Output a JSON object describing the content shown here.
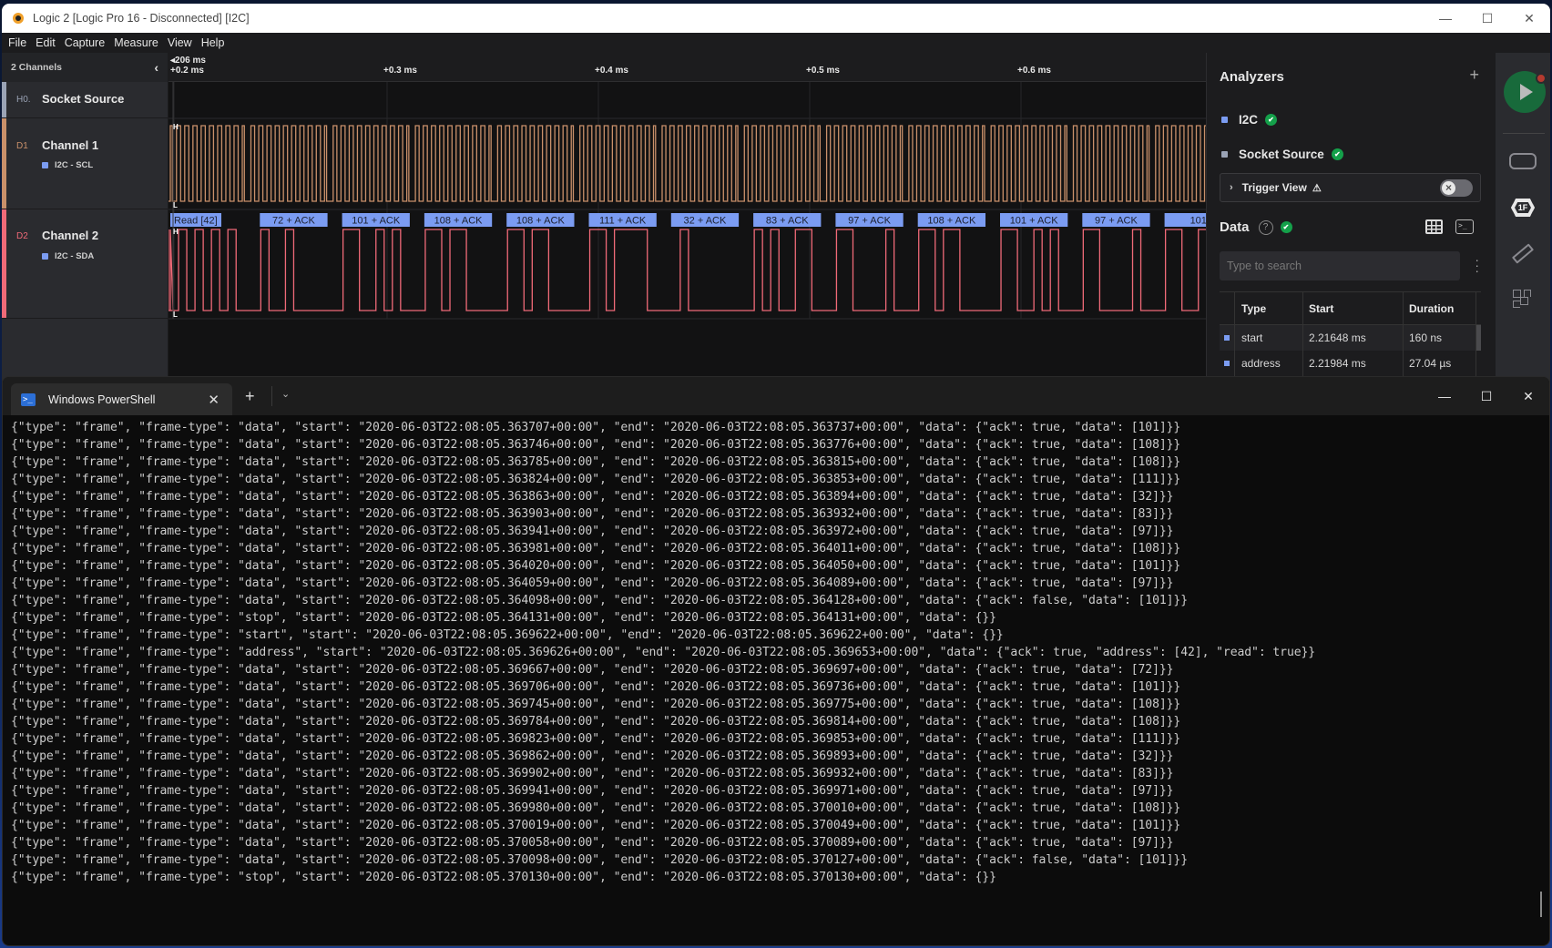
{
  "window": {
    "title": "Logic 2 [Logic Pro 16 - Disconnected] [I2C]",
    "controls": [
      "minimize",
      "maximize",
      "close"
    ]
  },
  "menu": [
    "File",
    "Edit",
    "Capture",
    "Measure",
    "View",
    "Help"
  ],
  "channels_panel": {
    "header": "2 Channels",
    "collapse_icon": "chevron-left-icon",
    "rows": [
      {
        "id": "H0.",
        "name": "Socket Source",
        "sub": "",
        "color": "#9aa3b5"
      },
      {
        "id": "D1",
        "name": "Channel 1",
        "sub": "I2C - SCL",
        "color": "#c9906a"
      },
      {
        "id": "D2",
        "name": "Channel 2",
        "sub": "I2C - SDA",
        "color": "#f06a78"
      }
    ]
  },
  "timeline": {
    "origin": "206 ms",
    "ticks": [
      "+0.2 ms",
      "+0.3 ms",
      "+0.4 ms",
      "+0.5 ms",
      "+0.6 ms"
    ],
    "level_high": "H",
    "level_low": "L"
  },
  "waveform": {
    "scl_color": "#c9906a",
    "sda_color": "#f06a78",
    "frame_label_color": "#7b9cf2",
    "frames": [
      {
        "label": "Read [42]",
        "value": 42,
        "kind": "address"
      },
      {
        "label": "72 + ACK",
        "value": 72,
        "kind": "data"
      },
      {
        "label": "101 + ACK",
        "value": 101,
        "kind": "data"
      },
      {
        "label": "108 + ACK",
        "value": 108,
        "kind": "data"
      },
      {
        "label": "108 + ACK",
        "value": 108,
        "kind": "data"
      },
      {
        "label": "111 + ACK",
        "value": 111,
        "kind": "data"
      },
      {
        "label": "32 + ACK",
        "value": 32,
        "kind": "data"
      },
      {
        "label": "83 + ACK",
        "value": 83,
        "kind": "data"
      },
      {
        "label": "97 + ACK",
        "value": 97,
        "kind": "data"
      },
      {
        "label": "108 + ACK",
        "value": 108,
        "kind": "data"
      },
      {
        "label": "101 + ACK",
        "value": 101,
        "kind": "data"
      },
      {
        "label": "97 + ACK",
        "value": 97,
        "kind": "data"
      },
      {
        "label": "101",
        "value": 101,
        "kind": "data"
      }
    ]
  },
  "analyzers": {
    "title": "Analyzers",
    "add_icon": "plus-icon",
    "items": [
      {
        "name": "I2C",
        "color": "#7b9cf2",
        "status": "ok"
      },
      {
        "name": "Socket Source",
        "color": "#9aa3b5",
        "status": "ok"
      }
    ],
    "trigger_view": {
      "label": "Trigger View",
      "warning_icon": "warning-icon",
      "enabled": false
    }
  },
  "data_panel": {
    "title": "Data",
    "search_placeholder": "Type to search",
    "columns": [
      "Type",
      "Start",
      "Duration"
    ],
    "rows": [
      {
        "type": "start",
        "start": "2.21648 ms",
        "duration": "160 ns"
      },
      {
        "type": "address",
        "start": "2.21984 ms",
        "duration": "27.04 µs"
      }
    ]
  },
  "toolstrip": {
    "run_button": "start-capture",
    "icons": [
      "device-settings-icon",
      "analyzers-1f-icon",
      "measure-ruler-icon",
      "extensions-icon"
    ]
  },
  "terminal": {
    "tab_label": "Windows PowerShell",
    "new_tab": "+",
    "lines": [
      "{\"type\": \"frame\", \"frame-type\": \"data\", \"start\": \"2020-06-03T22:08:05.363707+00:00\", \"end\": \"2020-06-03T22:08:05.363737+00:00\", \"data\": {\"ack\": true, \"data\": [101]}}",
      "{\"type\": \"frame\", \"frame-type\": \"data\", \"start\": \"2020-06-03T22:08:05.363746+00:00\", \"end\": \"2020-06-03T22:08:05.363776+00:00\", \"data\": {\"ack\": true, \"data\": [108]}}",
      "{\"type\": \"frame\", \"frame-type\": \"data\", \"start\": \"2020-06-03T22:08:05.363785+00:00\", \"end\": \"2020-06-03T22:08:05.363815+00:00\", \"data\": {\"ack\": true, \"data\": [108]}}",
      "{\"type\": \"frame\", \"frame-type\": \"data\", \"start\": \"2020-06-03T22:08:05.363824+00:00\", \"end\": \"2020-06-03T22:08:05.363853+00:00\", \"data\": {\"ack\": true, \"data\": [111]}}",
      "{\"type\": \"frame\", \"frame-type\": \"data\", \"start\": \"2020-06-03T22:08:05.363863+00:00\", \"end\": \"2020-06-03T22:08:05.363894+00:00\", \"data\": {\"ack\": true, \"data\": [32]}}",
      "{\"type\": \"frame\", \"frame-type\": \"data\", \"start\": \"2020-06-03T22:08:05.363903+00:00\", \"end\": \"2020-06-03T22:08:05.363932+00:00\", \"data\": {\"ack\": true, \"data\": [83]}}",
      "{\"type\": \"frame\", \"frame-type\": \"data\", \"start\": \"2020-06-03T22:08:05.363941+00:00\", \"end\": \"2020-06-03T22:08:05.363972+00:00\", \"data\": {\"ack\": true, \"data\": [97]}}",
      "{\"type\": \"frame\", \"frame-type\": \"data\", \"start\": \"2020-06-03T22:08:05.363981+00:00\", \"end\": \"2020-06-03T22:08:05.364011+00:00\", \"data\": {\"ack\": true, \"data\": [108]}}",
      "{\"type\": \"frame\", \"frame-type\": \"data\", \"start\": \"2020-06-03T22:08:05.364020+00:00\", \"end\": \"2020-06-03T22:08:05.364050+00:00\", \"data\": {\"ack\": true, \"data\": [101]}}",
      "{\"type\": \"frame\", \"frame-type\": \"data\", \"start\": \"2020-06-03T22:08:05.364059+00:00\", \"end\": \"2020-06-03T22:08:05.364089+00:00\", \"data\": {\"ack\": true, \"data\": [97]}}",
      "{\"type\": \"frame\", \"frame-type\": \"data\", \"start\": \"2020-06-03T22:08:05.364098+00:00\", \"end\": \"2020-06-03T22:08:05.364128+00:00\", \"data\": {\"ack\": false, \"data\": [101]}}",
      "{\"type\": \"frame\", \"frame-type\": \"stop\", \"start\": \"2020-06-03T22:08:05.364131+00:00\", \"end\": \"2020-06-03T22:08:05.364131+00:00\", \"data\": {}}",
      "{\"type\": \"frame\", \"frame-type\": \"start\", \"start\": \"2020-06-03T22:08:05.369622+00:00\", \"end\": \"2020-06-03T22:08:05.369622+00:00\", \"data\": {}}",
      "{\"type\": \"frame\", \"frame-type\": \"address\", \"start\": \"2020-06-03T22:08:05.369626+00:00\", \"end\": \"2020-06-03T22:08:05.369653+00:00\", \"data\": {\"ack\": true, \"address\": [42], \"read\": true}}",
      "{\"type\": \"frame\", \"frame-type\": \"data\", \"start\": \"2020-06-03T22:08:05.369667+00:00\", \"end\": \"2020-06-03T22:08:05.369697+00:00\", \"data\": {\"ack\": true, \"data\": [72]}}",
      "{\"type\": \"frame\", \"frame-type\": \"data\", \"start\": \"2020-06-03T22:08:05.369706+00:00\", \"end\": \"2020-06-03T22:08:05.369736+00:00\", \"data\": {\"ack\": true, \"data\": [101]}}",
      "{\"type\": \"frame\", \"frame-type\": \"data\", \"start\": \"2020-06-03T22:08:05.369745+00:00\", \"end\": \"2020-06-03T22:08:05.369775+00:00\", \"data\": {\"ack\": true, \"data\": [108]}}",
      "{\"type\": \"frame\", \"frame-type\": \"data\", \"start\": \"2020-06-03T22:08:05.369784+00:00\", \"end\": \"2020-06-03T22:08:05.369814+00:00\", \"data\": {\"ack\": true, \"data\": [108]}}",
      "{\"type\": \"frame\", \"frame-type\": \"data\", \"start\": \"2020-06-03T22:08:05.369823+00:00\", \"end\": \"2020-06-03T22:08:05.369853+00:00\", \"data\": {\"ack\": true, \"data\": [111]}}",
      "{\"type\": \"frame\", \"frame-type\": \"data\", \"start\": \"2020-06-03T22:08:05.369862+00:00\", \"end\": \"2020-06-03T22:08:05.369893+00:00\", \"data\": {\"ack\": true, \"data\": [32]}}",
      "{\"type\": \"frame\", \"frame-type\": \"data\", \"start\": \"2020-06-03T22:08:05.369902+00:00\", \"end\": \"2020-06-03T22:08:05.369932+00:00\", \"data\": {\"ack\": true, \"data\": [83]}}",
      "{\"type\": \"frame\", \"frame-type\": \"data\", \"start\": \"2020-06-03T22:08:05.369941+00:00\", \"end\": \"2020-06-03T22:08:05.369971+00:00\", \"data\": {\"ack\": true, \"data\": [97]}}",
      "{\"type\": \"frame\", \"frame-type\": \"data\", \"start\": \"2020-06-03T22:08:05.369980+00:00\", \"end\": \"2020-06-03T22:08:05.370010+00:00\", \"data\": {\"ack\": true, \"data\": [108]}}",
      "{\"type\": \"frame\", \"frame-type\": \"data\", \"start\": \"2020-06-03T22:08:05.370019+00:00\", \"end\": \"2020-06-03T22:08:05.370049+00:00\", \"data\": {\"ack\": true, \"data\": [101]}}",
      "{\"type\": \"frame\", \"frame-type\": \"data\", \"start\": \"2020-06-03T22:08:05.370058+00:00\", \"end\": \"2020-06-03T22:08:05.370089+00:00\", \"data\": {\"ack\": true, \"data\": [97]}}",
      "{\"type\": \"frame\", \"frame-type\": \"data\", \"start\": \"2020-06-03T22:08:05.370098+00:00\", \"end\": \"2020-06-03T22:08:05.370127+00:00\", \"data\": {\"ack\": false, \"data\": [101]}}",
      "{\"type\": \"frame\", \"frame-type\": \"stop\", \"start\": \"2020-06-03T22:08:05.370130+00:00\", \"end\": \"2020-06-03T22:08:05.370130+00:00\", \"data\": {}}"
    ]
  }
}
